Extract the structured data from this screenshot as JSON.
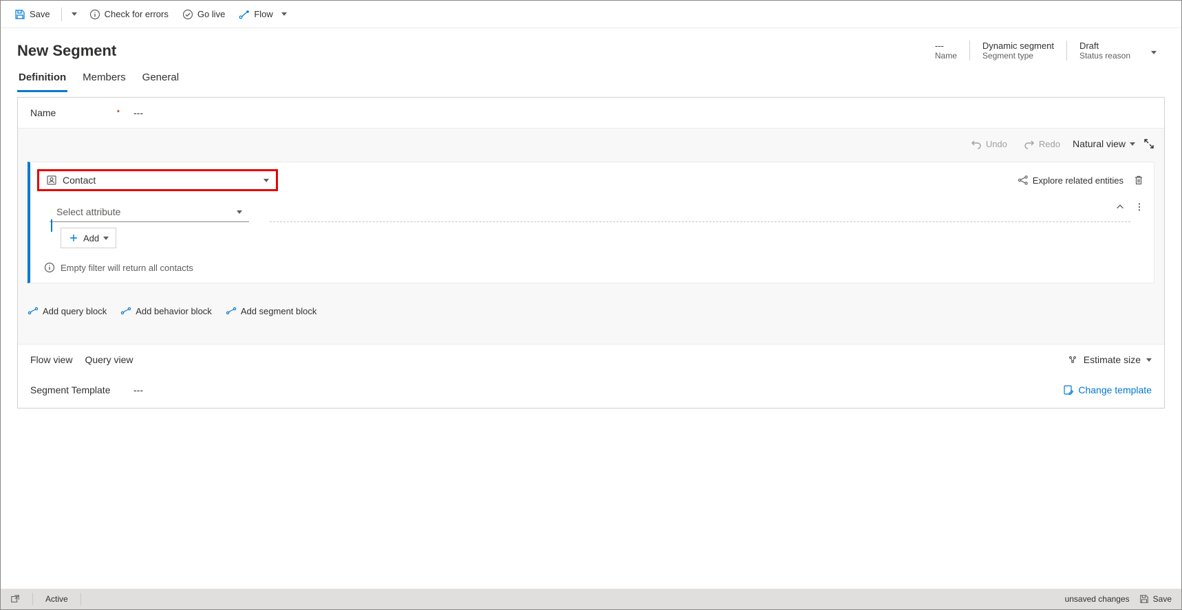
{
  "toolbar": {
    "save": "Save",
    "check_errors": "Check for errors",
    "go_live": "Go live",
    "flow": "Flow"
  },
  "header": {
    "title": "New Segment",
    "meta": {
      "name_val": "---",
      "name_label": "Name",
      "type_val": "Dynamic segment",
      "type_label": "Segment type",
      "status_val": "Draft",
      "status_label": "Status reason"
    }
  },
  "tabs": {
    "definition": "Definition",
    "members": "Members",
    "general": "General"
  },
  "nameField": {
    "label": "Name",
    "value": "---"
  },
  "designerToolbar": {
    "undo": "Undo",
    "redo": "Redo",
    "view": "Natural view"
  },
  "block": {
    "entity": "Contact",
    "explore": "Explore related entities",
    "selectAttribute": "Select attribute",
    "add": "Add",
    "emptyFilterInfo": "Empty filter will return all contacts"
  },
  "addBlocks": {
    "query": "Add query block",
    "behavior": "Add behavior block",
    "segment": "Add segment block"
  },
  "views": {
    "flow": "Flow view",
    "query": "Query view",
    "estimate": "Estimate size"
  },
  "template": {
    "label": "Segment Template",
    "value": "---",
    "change": "Change template"
  },
  "statusbar": {
    "state": "Active",
    "unsaved": "unsaved changes",
    "save": "Save"
  }
}
